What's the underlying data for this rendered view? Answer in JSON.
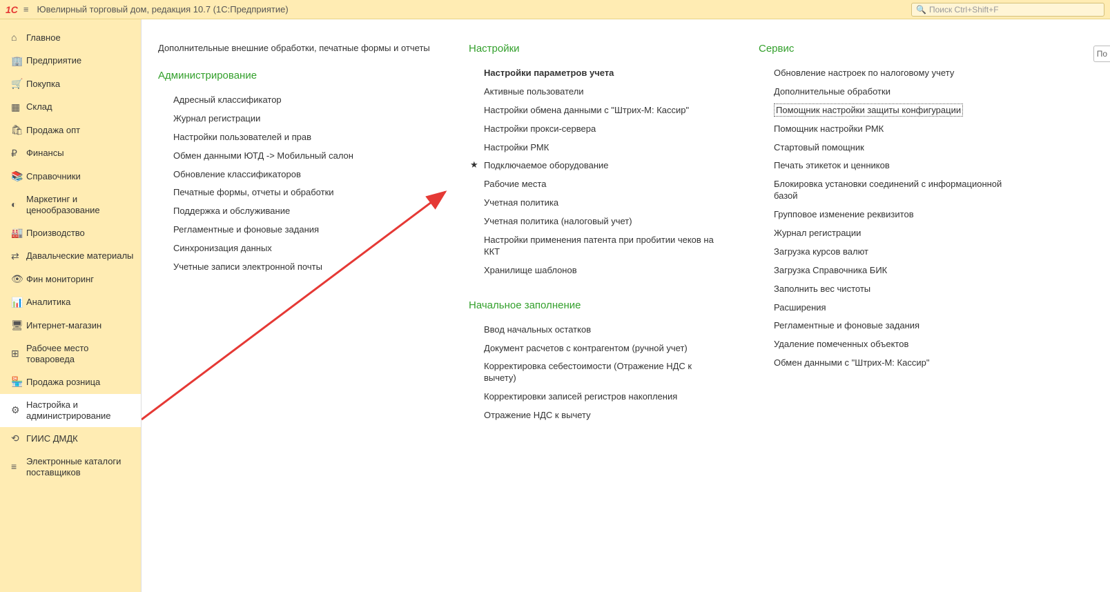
{
  "header": {
    "app_title": "Ювелирный торговый дом, редакция 10.7  (1С:Предприятие)",
    "search_placeholder": "Поиск Ctrl+Shift+F"
  },
  "right_cut": "По",
  "sidebar": {
    "items": [
      {
        "icon": "⌂",
        "label": "Главное"
      },
      {
        "icon": "🏢",
        "label": "Предприятие"
      },
      {
        "icon": "🛒",
        "label": "Покупка"
      },
      {
        "icon": "▦",
        "label": "Склад"
      },
      {
        "icon": "🛍",
        "label": "Продажа опт"
      },
      {
        "icon": "₽",
        "label": "Финансы"
      },
      {
        "icon": "📚",
        "label": "Справочники"
      },
      {
        "icon": "◐",
        "label": "Маркетинг и ценообразование"
      },
      {
        "icon": "🏭",
        "label": "Производство"
      },
      {
        "icon": "⇄",
        "label": "Давальческие материалы"
      },
      {
        "icon": "👁",
        "label": "Фин мониторинг"
      },
      {
        "icon": "📊",
        "label": "Аналитика"
      },
      {
        "icon": "🖥",
        "label": "Интернет-магазин"
      },
      {
        "icon": "⊞",
        "label": "Рабочее место товароведа"
      },
      {
        "icon": "🏪",
        "label": "Продажа розница"
      },
      {
        "icon": "⚙",
        "label": "Настройка и администрирование"
      },
      {
        "icon": "⟲",
        "label": "ГИИС ДМДК"
      },
      {
        "icon": "≡",
        "label": "Электронные каталоги поставщиков"
      }
    ],
    "active": 15
  },
  "col1": {
    "top_link": "Дополнительные внешние обработки, печатные формы и отчеты",
    "header": "Администрирование",
    "items": [
      "Адресный классификатор",
      "Журнал регистрации",
      "Настройки пользователей и прав",
      "Обмен данными ЮТД -> Мобильный салон",
      "Обновление классификаторов",
      "Печатные формы, отчеты и обработки",
      "Поддержка и обслуживание",
      "Регламентные и фоновые задания",
      "Синхронизация данных",
      "Учетные записи электронной почты"
    ]
  },
  "col2": {
    "sec1_header": "Настройки",
    "sec1_items": [
      {
        "label": "Настройки параметров учета",
        "bold": true
      },
      {
        "label": "Активные пользователи"
      },
      {
        "label": "Настройки обмена данными с \"Штрих-М: Кассир\""
      },
      {
        "label": "Настройки прокси-сервера"
      },
      {
        "label": "Настройки РМК"
      },
      {
        "label": "Подключаемое оборудование",
        "star": true
      },
      {
        "label": "Рабочие места"
      },
      {
        "label": "Учетная политика"
      },
      {
        "label": "Учетная политика (налоговый учет)"
      },
      {
        "label": "Настройки применения патента при пробитии чеков на ККТ"
      },
      {
        "label": "Хранилище шаблонов"
      }
    ],
    "sec2_header": "Начальное заполнение",
    "sec2_items": [
      "Ввод начальных остатков",
      "Документ расчетов с контрагентом (ручной учет)",
      "Корректировка себестоимости (Отражение НДС к вычету)",
      "Корректировки записей регистров накопления",
      "Отражение НДС к вычету"
    ]
  },
  "col3": {
    "header": "Сервис",
    "items": [
      {
        "label": "Обновление настроек по налоговому учету"
      },
      {
        "label": "Дополнительные обработки"
      },
      {
        "label": "Помощник настройки защиты конфигурации",
        "boxed": true
      },
      {
        "label": "Помощник настройки РМК"
      },
      {
        "label": "Стартовый помощник"
      },
      {
        "label": "Печать этикеток и ценников"
      },
      {
        "label": "Блокировка установки соединений с информационной базой"
      },
      {
        "label": "Групповое изменение реквизитов"
      },
      {
        "label": "Журнал регистрации"
      },
      {
        "label": "Загрузка курсов валют"
      },
      {
        "label": "Загрузка Справочника БИК"
      },
      {
        "label": "Заполнить вес чистоты"
      },
      {
        "label": "Расширения"
      },
      {
        "label": "Регламентные и фоновые задания"
      },
      {
        "label": "Удаление помеченных объектов"
      },
      {
        "label": "Обмен данными с \"Штрих-М: Кассир\""
      }
    ]
  }
}
